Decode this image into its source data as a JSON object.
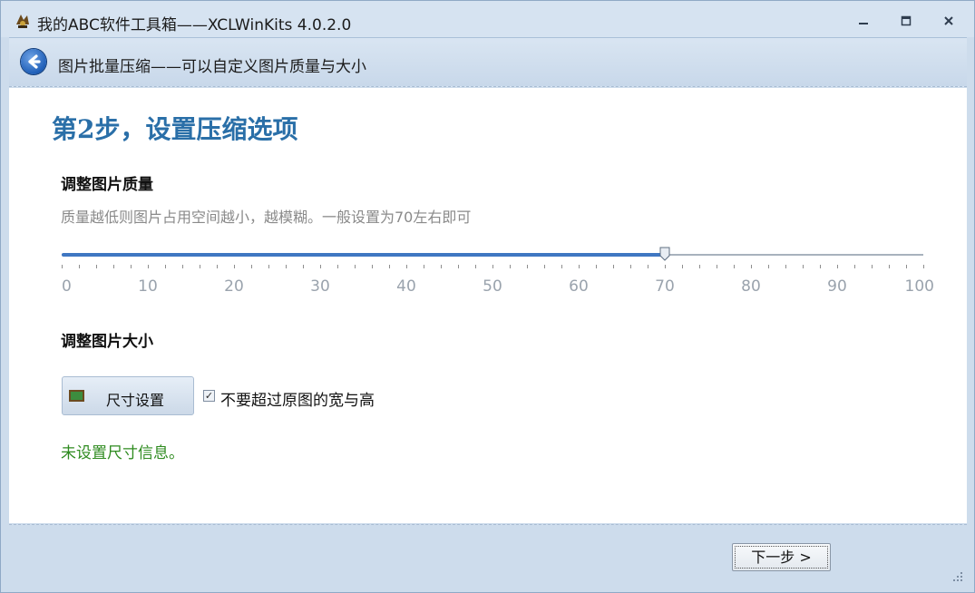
{
  "window": {
    "title": "我的ABC软件工具箱——XCLWinKits  4.0.2.0"
  },
  "header": {
    "subtitle": "图片批量压缩——可以自定义图片质量与大小"
  },
  "content": {
    "step_title": "第2步，设置压缩选项",
    "quality_label": "调整图片质量",
    "quality_hint": "质量越低则图片占用空间越小，越模糊。一般设置为70左右即可",
    "slider": {
      "min": 0,
      "max": 100,
      "value": 70,
      "tick_labels": [
        "0",
        "10",
        "20",
        "30",
        "40",
        "50",
        "60",
        "70",
        "80",
        "90",
        "100"
      ],
      "fill_color": "#3f77c2"
    },
    "size_label": "调整图片大小",
    "size_button_label": "尺寸设置",
    "keep_original_checkbox": {
      "label": "不要超过原图的宽与高",
      "checked": true
    },
    "status_message": "未设置尺寸信息。"
  },
  "footer": {
    "next_button_label": "下一步 >"
  },
  "colors": {
    "accent": "#2a6fa8",
    "status_green": "#2e8b1f"
  }
}
